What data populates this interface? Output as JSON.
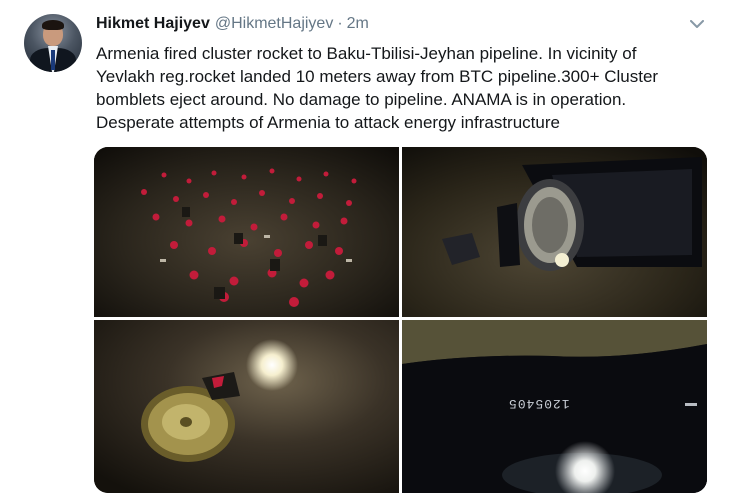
{
  "tweet": {
    "author_name": "Hikmet Hajiyev",
    "author_handle": "@HikmetHajiyev",
    "separator": "·",
    "timestamp": "2m",
    "text_lines": [
      "Armenia fired cluster rocket to Baku-Tbilisi-Jeyhan pipeline. In vicinity of",
      "Yevlakh reg.rocket landed 10 meters away from BTC pipeline.300+ Cluster",
      "bomblets eject around. No damage to pipeline. ANAMA is in operation.",
      "Desperate attempts of Armenia to attack energy infrastructure"
    ],
    "photo_serial_text": "1205405"
  },
  "icons": {
    "avatar": "profile-photo",
    "menu": "chevron-down-icon"
  },
  "colors": {
    "text_primary": "#14171a",
    "text_secondary": "#657786",
    "caret": "#8899a6",
    "background": "#ffffff"
  }
}
